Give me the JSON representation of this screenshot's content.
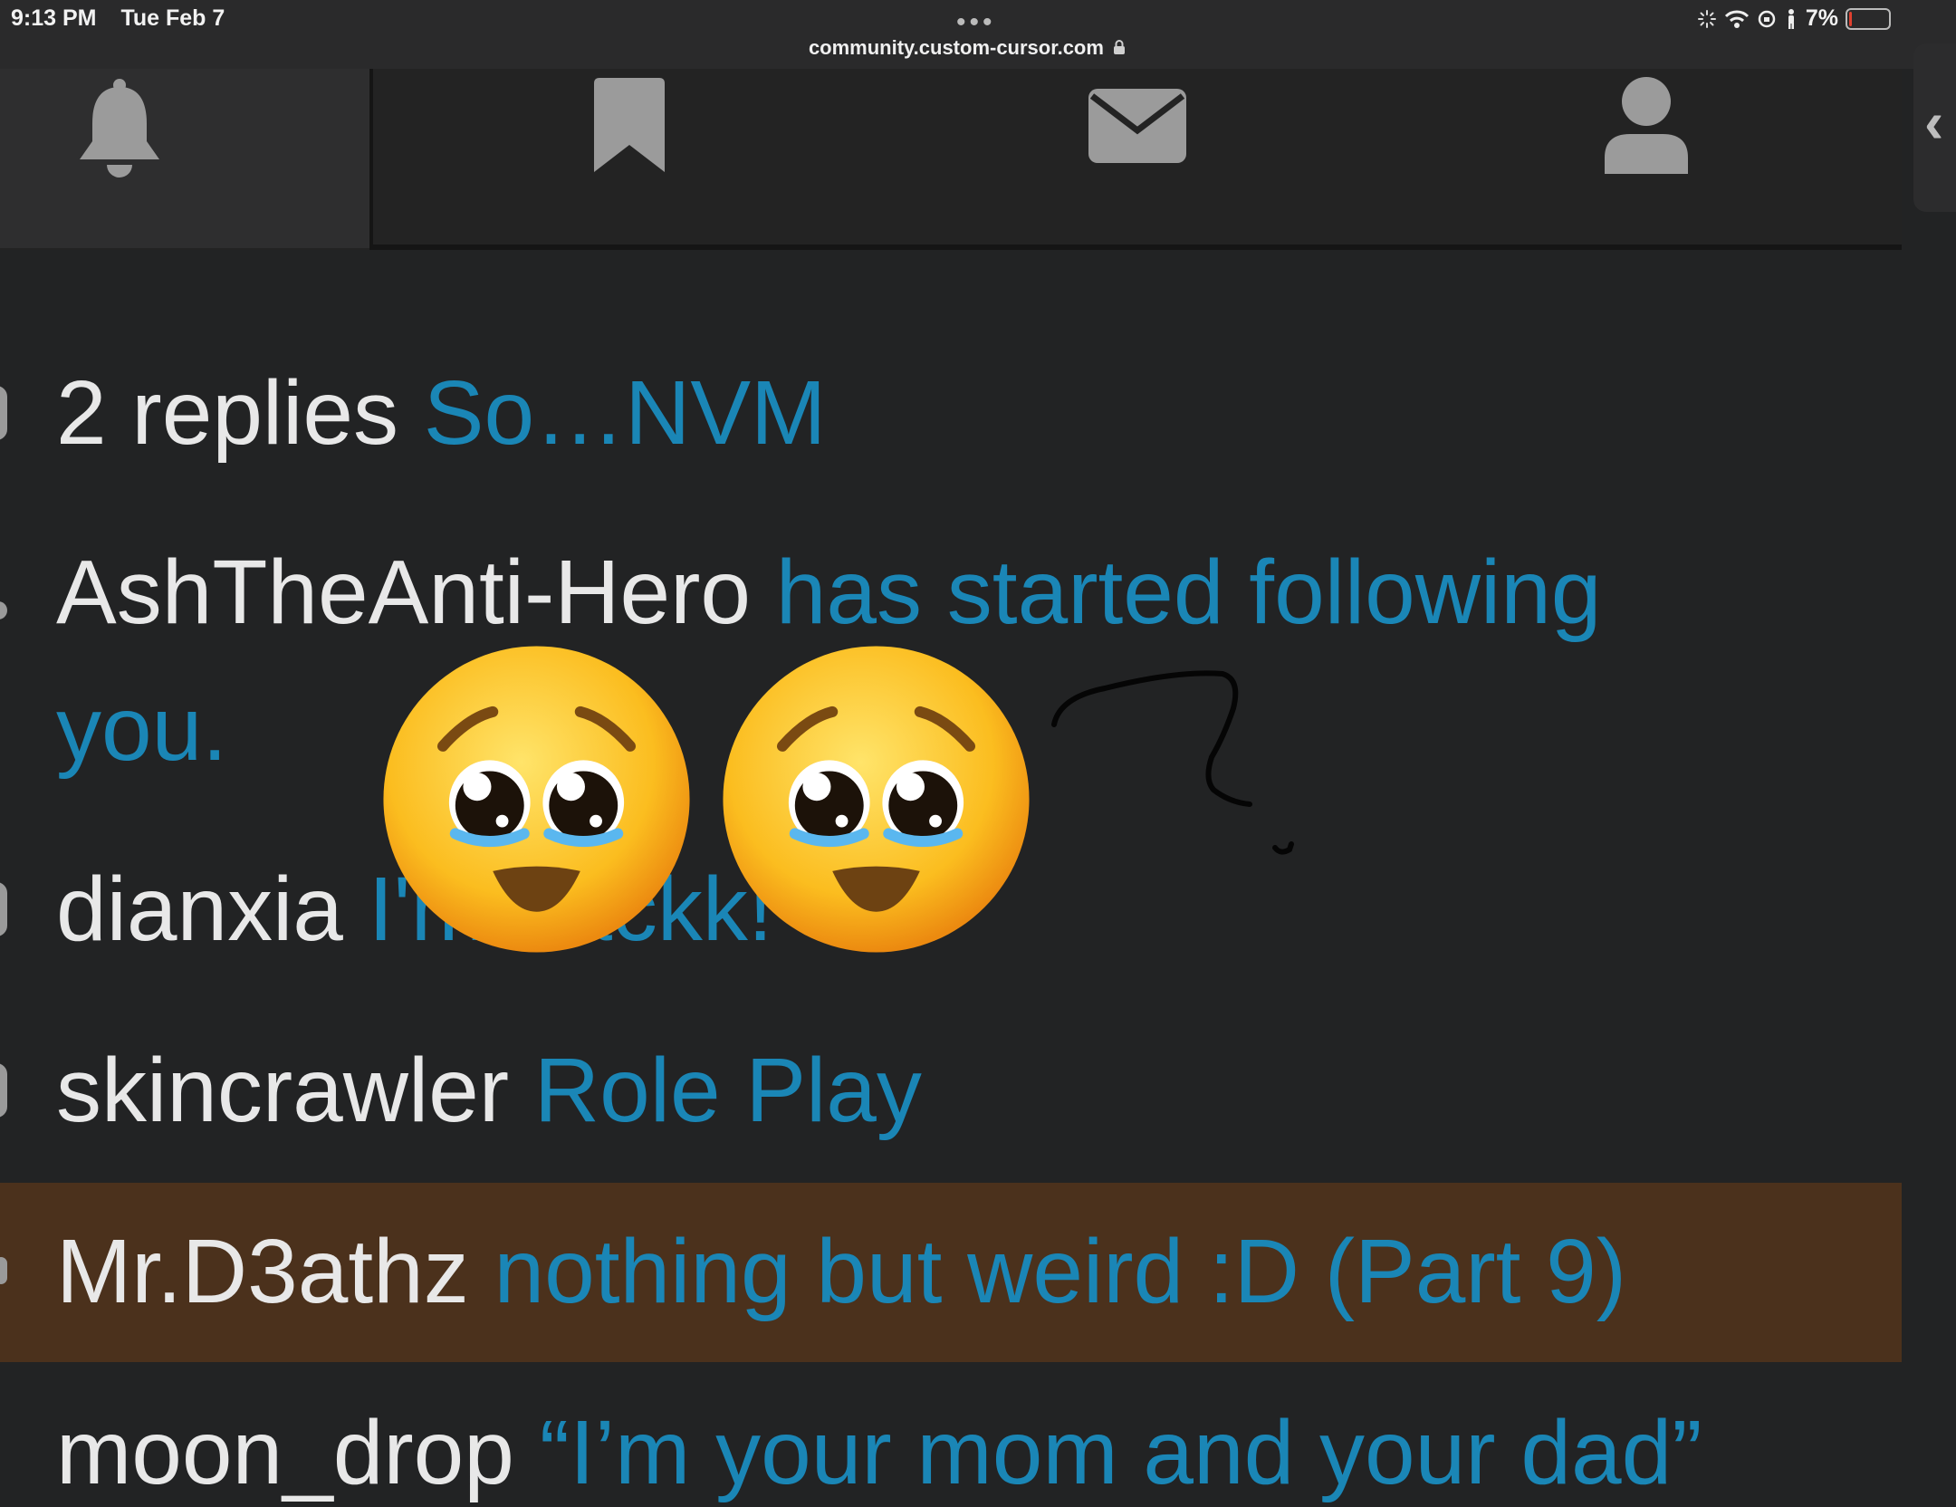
{
  "status_bar": {
    "time": "9:13 PM",
    "date": "Tue Feb 7",
    "battery": "7%",
    "battery_level": 0.07,
    "url": "community.custom-cursor.com",
    "more_dots": "•••"
  },
  "nav": {
    "icons": [
      "bell-icon",
      "bookmark-icon",
      "envelope-icon",
      "user-icon"
    ],
    "side_tab_glyph": "‹"
  },
  "notifications": [
    {
      "user": "2 replies",
      "topic": "So…NVM"
    },
    {
      "user": "AshTheAnti-Hero",
      "topic": "has started following you.",
      "topic_line1": "has started following",
      "topic_line2": "you."
    },
    {
      "user": "dianxia",
      "topic": "I'm backk!"
    },
    {
      "user": "skincrawler",
      "topic": "Role Play"
    },
    {
      "user": "Mr.D3athz",
      "topic": "nothing but weird :D (Part 9)"
    },
    {
      "user": "moon_drop",
      "topic": "“I’m your mom and your dad”"
    }
  ],
  "overlay": {
    "emoji": [
      "🥺",
      "🥺"
    ]
  },
  "colors": {
    "background": "#222324",
    "link": "#1a86b6",
    "highlight_row": "#4b311c"
  }
}
